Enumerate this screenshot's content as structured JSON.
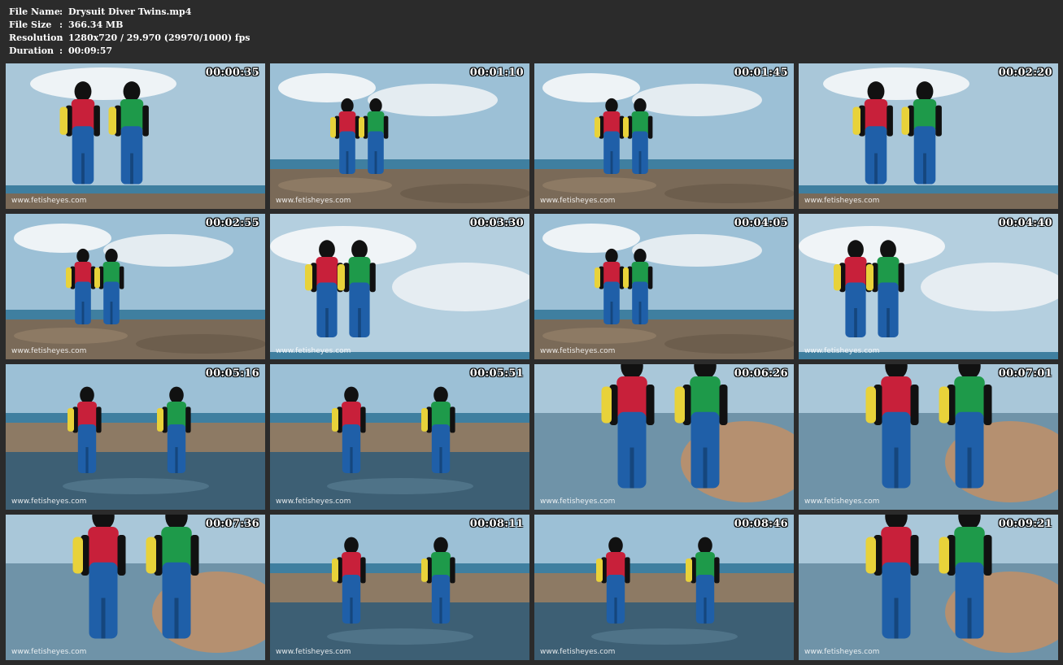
{
  "header": {
    "file_name_label": "File Name",
    "file_name": "Drysuit Diver Twins.mp4",
    "file_size_label": "File Size",
    "file_size": "366.34 MB",
    "resolution_label": "Resolution",
    "resolution": "1280x720 / 29.970 (29970/1000) fps",
    "duration_label": "Duration",
    "duration": "00:09:57",
    "separator": ":"
  },
  "watermark": "www.fetisheyes.com",
  "colors": {
    "background": "#2b2b2b",
    "diver_red": "#c8203a",
    "diver_green": "#1e9a4a",
    "drysuit_blue": "#1f5fa8",
    "tank_yellow": "#e8d23a"
  },
  "thumbnails": [
    {
      "timestamp": "00:00:35",
      "scene": "beach-close"
    },
    {
      "timestamp": "00:01:10",
      "scene": "beach-wide"
    },
    {
      "timestamp": "00:01:45",
      "scene": "beach-wide"
    },
    {
      "timestamp": "00:02:20",
      "scene": "beach-close"
    },
    {
      "timestamp": "00:02:55",
      "scene": "beach-wide"
    },
    {
      "timestamp": "00:03:30",
      "scene": "sky-close"
    },
    {
      "timestamp": "00:04:05",
      "scene": "beach-wide"
    },
    {
      "timestamp": "00:04:40",
      "scene": "sky-close"
    },
    {
      "timestamp": "00:05:16",
      "scene": "water"
    },
    {
      "timestamp": "00:05:51",
      "scene": "water"
    },
    {
      "timestamp": "00:06:26",
      "scene": "closeup"
    },
    {
      "timestamp": "00:07:01",
      "scene": "closeup"
    },
    {
      "timestamp": "00:07:36",
      "scene": "closeup"
    },
    {
      "timestamp": "00:08:11",
      "scene": "water"
    },
    {
      "timestamp": "00:08:46",
      "scene": "water"
    },
    {
      "timestamp": "00:09:21",
      "scene": "closeup"
    }
  ]
}
